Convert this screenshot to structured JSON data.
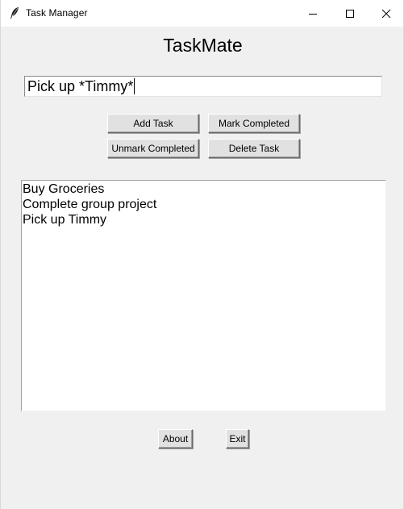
{
  "window": {
    "title": "Task Manager",
    "controls": {
      "minimize": "minimize-icon",
      "maximize": "maximize-icon",
      "close": "close-icon"
    }
  },
  "app": {
    "heading": "TaskMate"
  },
  "task_input": {
    "value": "Pick up *Timmy*"
  },
  "buttons": {
    "add": "Add Task",
    "mark": "Mark Completed",
    "unmark": "Unmark Completed",
    "delete": "Delete Task",
    "about": "About",
    "exit": "Exit"
  },
  "tasks": [
    "Buy Groceries",
    "Complete group project",
    "Pick up Timmy"
  ],
  "colors": {
    "window_bg": "#f0f0f0",
    "titlebar_bg": "#ffffff",
    "button_bg": "#e1e1e1",
    "list_bg": "#ffffff"
  }
}
